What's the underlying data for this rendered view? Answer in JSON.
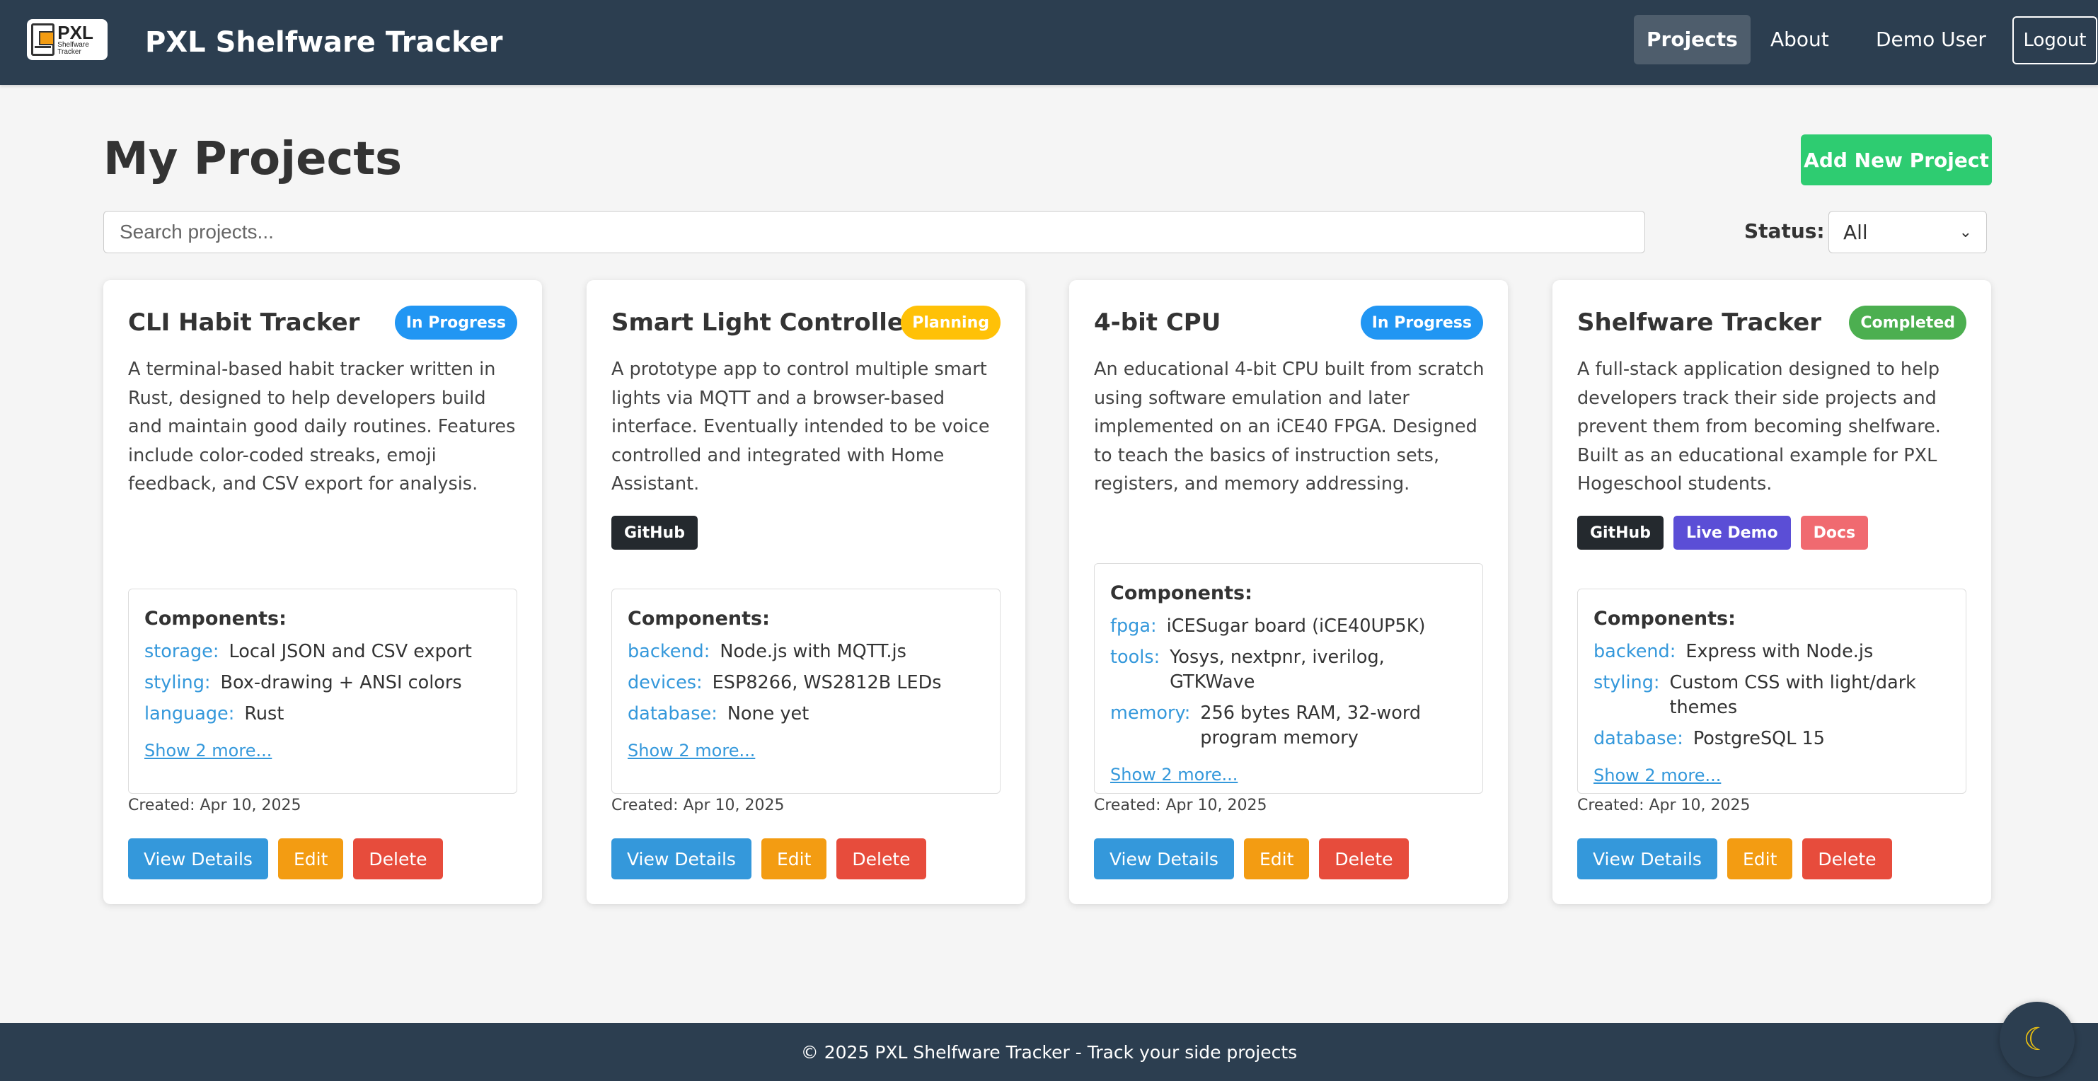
{
  "navbar": {
    "logo_text": "PXL",
    "logo_sub": "Shelfware Tracker",
    "brand": "PXL Shelfware Tracker",
    "links": [
      "Projects",
      "About",
      "Demo User"
    ],
    "logout": "Logout"
  },
  "page": {
    "title": "My Projects",
    "add_button": "Add New Project",
    "search_placeholder": "Search projects...",
    "status_label": "Status:",
    "status_value": "All"
  },
  "colors": {
    "in_progress": "#2196f3",
    "planning": "#ffc107",
    "completed": "#4caf50",
    "github": "#24292e",
    "live_demo": "#5b4ed6",
    "docs": "#f06a70"
  },
  "projects": [
    {
      "title": "CLI Habit Tracker",
      "status": "In Progress",
      "description": "A terminal-based habit tracker written in Rust, designed to help developers build and maintain good daily routines. Features include color-coded streaks, emoji feedback, and CSV export for analysis.",
      "links": [],
      "components_heading": "Components:",
      "components": [
        {
          "key": "storage:",
          "value": "Local JSON and CSV export"
        },
        {
          "key": "styling:",
          "value": "Box-drawing + ANSI colors"
        },
        {
          "key": "language:",
          "value": "Rust"
        }
      ],
      "show_more": "Show 2 more...",
      "created": "Created: Apr 10, 2025",
      "actions": [
        "View Details",
        "Edit",
        "Delete"
      ]
    },
    {
      "title": "Smart Light Controller",
      "status": "Planning",
      "description": "A prototype app to control multiple smart lights via MQTT and a browser-based interface. Eventually intended to be voice controlled and integrated with Home Assistant.",
      "links": [
        "GitHub"
      ],
      "components_heading": "Components:",
      "components": [
        {
          "key": "backend:",
          "value": "Node.js with MQTT.js"
        },
        {
          "key": "devices:",
          "value": "ESP8266, WS2812B LEDs"
        },
        {
          "key": "database:",
          "value": "None yet"
        }
      ],
      "show_more": "Show 2 more...",
      "created": "Created: Apr 10, 2025",
      "actions": [
        "View Details",
        "Edit",
        "Delete"
      ]
    },
    {
      "title": "4-bit CPU",
      "status": "In Progress",
      "description": "An educational 4-bit CPU built from scratch using software emulation and later implemented on an iCE40 FPGA. Designed to teach the basics of instruction sets, registers, and memory addressing.",
      "links": [],
      "components_heading": "Components:",
      "components": [
        {
          "key": "fpga:",
          "value": "iCESugar board (iCE40UP5K)"
        },
        {
          "key": "tools:",
          "value": "Yosys, nextpnr, iverilog, GTKWave"
        },
        {
          "key": "memory:",
          "value": "256 bytes RAM, 32-word program memory"
        }
      ],
      "show_more": "Show 2 more...",
      "created": "Created: Apr 10, 2025",
      "actions": [
        "View Details",
        "Edit",
        "Delete"
      ]
    },
    {
      "title": "Shelfware Tracker",
      "status": "Completed",
      "description": "A full-stack application designed to help developers track their side projects and prevent them from becoming shelfware. Built as an educational example for PXL Hogeschool students.",
      "links": [
        "GitHub",
        "Live Demo",
        "Docs"
      ],
      "components_heading": "Components:",
      "components": [
        {
          "key": "backend:",
          "value": "Express with Node.js"
        },
        {
          "key": "styling:",
          "value": "Custom CSS with light/dark themes"
        },
        {
          "key": "database:",
          "value": "PostgreSQL 15"
        }
      ],
      "show_more": "Show 2 more...",
      "created": "Created: Apr 10, 2025",
      "actions": [
        "View Details",
        "Edit",
        "Delete"
      ]
    }
  ],
  "footer": {
    "text": "© 2025 PXL Shelfware Tracker - Track your side projects"
  },
  "theme_toggle_icon": "moon-icon"
}
